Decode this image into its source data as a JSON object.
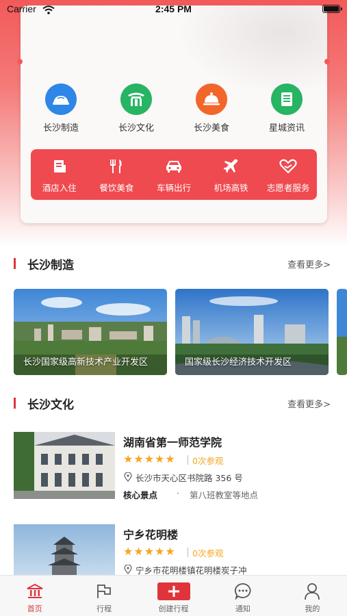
{
  "status": {
    "carrier": "Carrier",
    "time": "2:45 PM"
  },
  "colors": {
    "accent": "#ef4a4f",
    "tab_active": "#e0343b",
    "star": "#f5a623"
  },
  "categories": [
    {
      "label": "长沙制造",
      "icon": "factory-icon",
      "color": "#2e86e6"
    },
    {
      "label": "长沙文化",
      "icon": "gate-icon",
      "color": "#27b463"
    },
    {
      "label": "长沙美食",
      "icon": "dish-icon",
      "color": "#f2662a"
    },
    {
      "label": "星城资讯",
      "icon": "news-icon",
      "color": "#27b463"
    }
  ],
  "services": [
    {
      "label": "酒店入住",
      "icon": "hotel-icon"
    },
    {
      "label": "餐饮美食",
      "icon": "fork-knife-icon"
    },
    {
      "label": "车辆出行",
      "icon": "car-icon"
    },
    {
      "label": "机场高铁",
      "icon": "plane-icon"
    },
    {
      "label": "志愿者服务",
      "icon": "heart-hands-icon"
    }
  ],
  "section_manufacturing": {
    "title": "长沙制造",
    "more": "查看更多>",
    "tiles": [
      {
        "caption": "长沙国家级高新技术产业开发区"
      },
      {
        "caption": "国家级长沙经济技术开发区"
      }
    ]
  },
  "section_culture": {
    "title": "长沙文化",
    "more": "查看更多>",
    "items": [
      {
        "title": "湖南省第一师范学院",
        "stars": "★★★★★",
        "views": "0次参观",
        "address": "长沙市天心区书院路 356 号",
        "sight_label": "核心景点",
        "sight_dot": "·",
        "sights": "第八班教室等地点"
      },
      {
        "title": "宁乡花明楼",
        "stars": "★★★★★",
        "views": "0次参观",
        "address": "宁乡市花明楼镇花明楼炭子冲"
      }
    ]
  },
  "tabbar": [
    {
      "label": "首页",
      "icon": "home-icon",
      "active": true
    },
    {
      "label": "行程",
      "icon": "flag-icon",
      "active": false
    },
    {
      "label": "创建行程",
      "icon": "plus-icon",
      "active": false
    },
    {
      "label": "通知",
      "icon": "chat-icon",
      "active": false
    },
    {
      "label": "我的",
      "icon": "user-icon",
      "active": false
    }
  ]
}
